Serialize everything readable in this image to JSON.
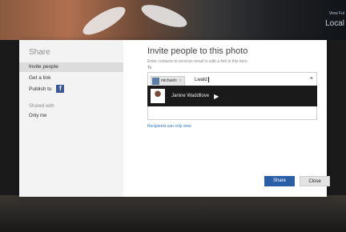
{
  "background": {
    "top_right_small": "View Ful",
    "top_right_large": "Local"
  },
  "sidebar": {
    "title": "Share",
    "items": [
      {
        "label": "Invite people"
      },
      {
        "label": "Get a link"
      },
      {
        "label": "Publish to"
      }
    ],
    "facebook_letter": "f",
    "shared_with_label": "Shared with",
    "shared_with_value": "Only me"
  },
  "main": {
    "title": "Invite people to this photo",
    "hint": "Enter contacts to send an email to with a link to this item.",
    "to_label": "To",
    "recipient_chip": "michaels",
    "typed_text": "Lwald",
    "clear_symbol": "×",
    "suggestion_name": "Janine Waddllove",
    "recipients_link": "Recipients can only view"
  },
  "buttons": {
    "share": "Share",
    "close": "Close"
  },
  "colors": {
    "primary_button": "#2a5fa8",
    "link": "#2b78c6",
    "suggestion_bg": "#1a1a1a",
    "sidebar_bg": "#f3f3f3"
  }
}
